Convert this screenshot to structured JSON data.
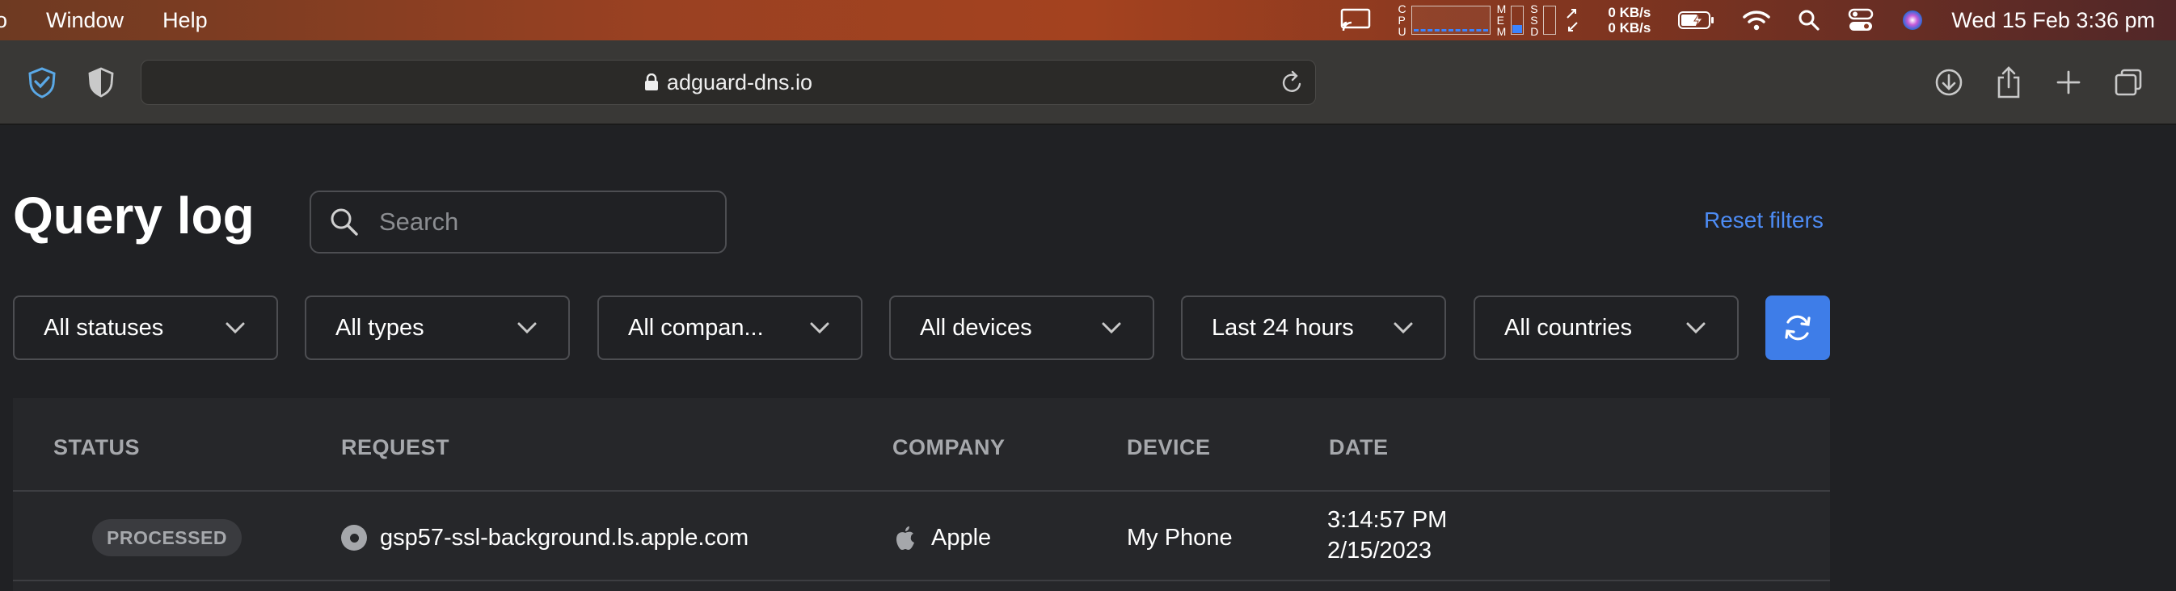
{
  "menubar": {
    "items": [
      "o",
      "Window",
      "Help"
    ],
    "cpu_label": "CPU",
    "mem_label": "MEM",
    "ssd_label": "SSD",
    "net_up": "0 KB/s",
    "net_down": "0 KB/s",
    "datetime": "Wed 15 Feb  3:36 pm"
  },
  "browser": {
    "url": "adguard-dns.io"
  },
  "page": {
    "title": "Query log",
    "search_placeholder": "Search",
    "reset_filters": "Reset filters",
    "filters": [
      "All statuses",
      "All types",
      "All compan...",
      "All devices",
      "Last 24 hours",
      "All countries"
    ],
    "accent": "#3e7de8"
  },
  "table": {
    "headers": [
      "STATUS",
      "REQUEST",
      "COMPANY",
      "DEVICE",
      "DATE"
    ],
    "rows": [
      {
        "status": "PROCESSED",
        "request": "gsp57-ssl-background.ls.apple.com",
        "company": "Apple",
        "device": "My Phone",
        "time": "3:14:57 PM",
        "date": "2/15/2023"
      }
    ]
  }
}
